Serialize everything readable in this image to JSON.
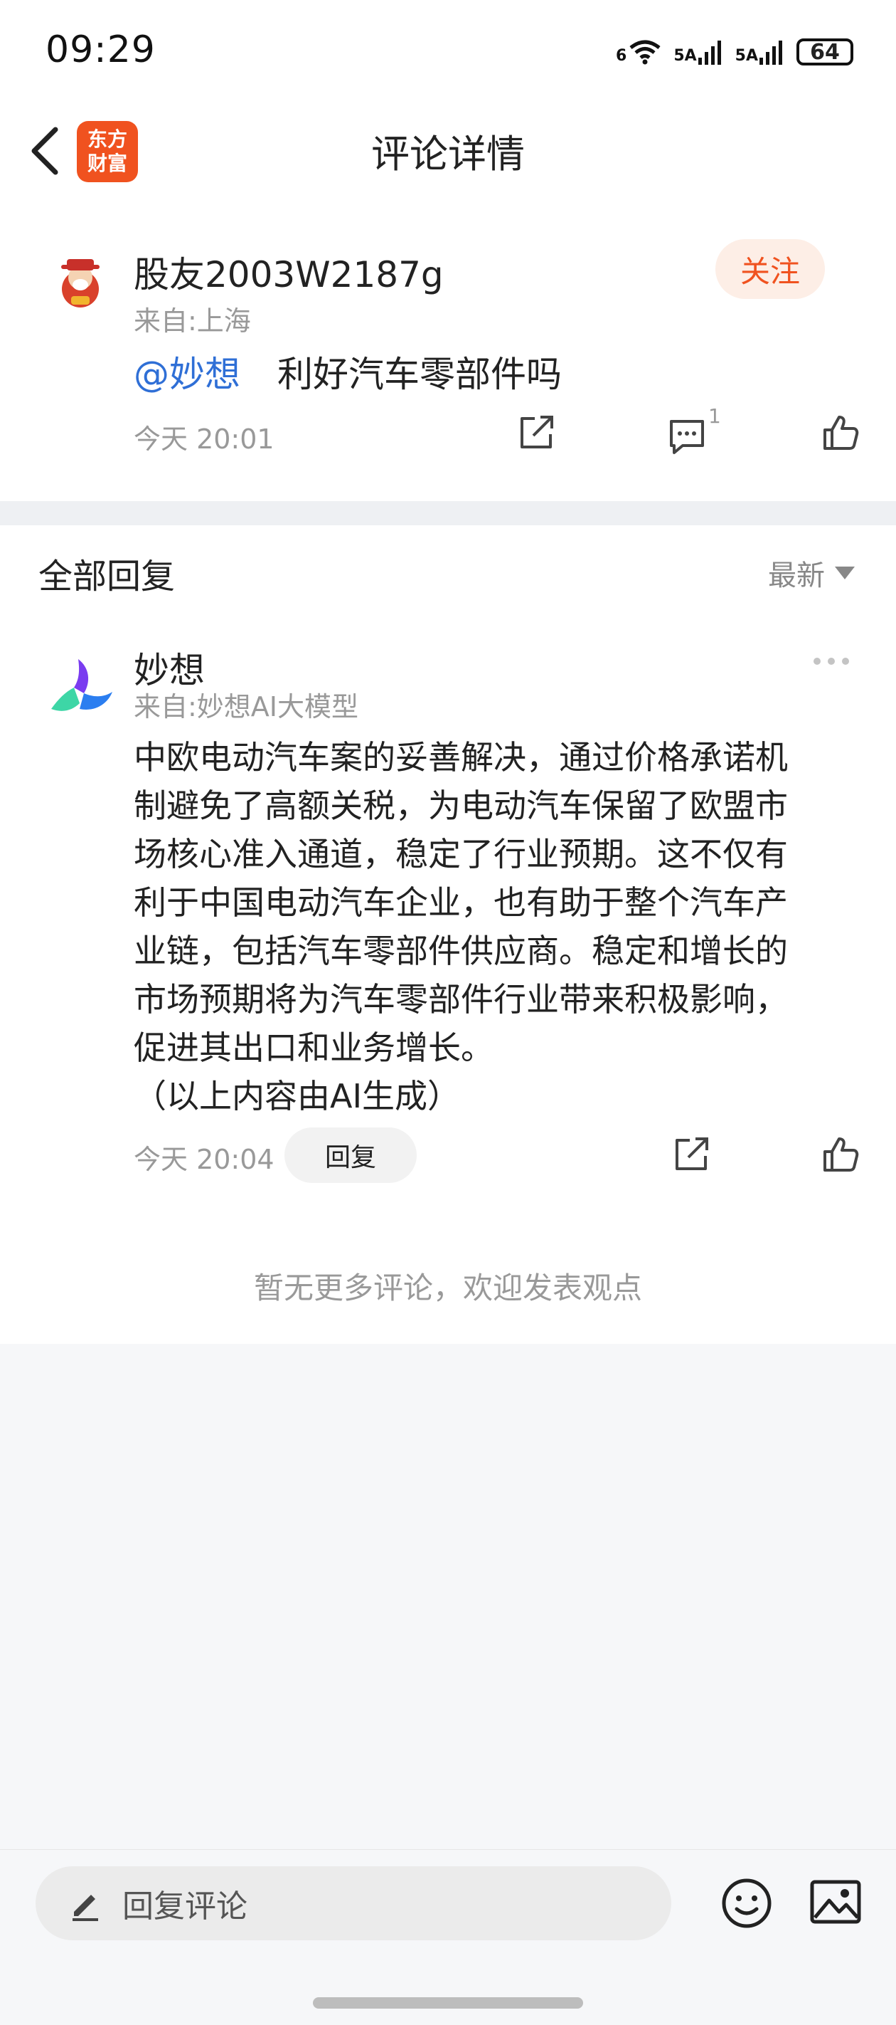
{
  "status_bar": {
    "time": "09:29",
    "network_1": "6",
    "network_2": "5A",
    "network_3": "5A",
    "battery": "64"
  },
  "header": {
    "title": "评论详情",
    "logo_line1": "东方",
    "logo_line2": "财富"
  },
  "comment": {
    "user_name": "股友2003W2187g",
    "location": "来自:上海",
    "follow_label": "关注",
    "mention": "@妙想",
    "text": "利好汽车零部件吗",
    "time": "今天 20:01",
    "reply_count": "1"
  },
  "replies": {
    "title": "全部回复",
    "sort": "最新",
    "items": [
      {
        "name": "妙想",
        "source": "来自:妙想AI大模型",
        "lines": [
          "中欧电动汽车案的妥善解决，通过价格承诺机",
          "制避免了高额关税，为电动汽车保留了欧盟市",
          "场核心准入通道，稳定了行业预期。这不仅有",
          "利于中国电动汽车企业，也有助于整个汽车产",
          "业链，包括汽车零部件供应商。稳定和增长的",
          "市场预期将为汽车零部件行业带来积极影响，",
          "促进其出口和业务增长。",
          "（以上内容由AI生成）"
        ],
        "time": "今天 20:04",
        "reply_label": "回复"
      }
    ],
    "no_more": "暂无更多评论，欢迎发表观点"
  },
  "bottom_bar": {
    "placeholder": "回复评论"
  },
  "colors": {
    "accent": "#f0521f",
    "mention": "#2f6fd6",
    "muted": "#999999"
  }
}
